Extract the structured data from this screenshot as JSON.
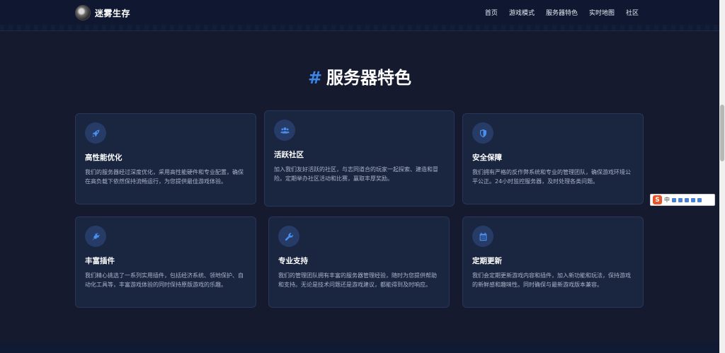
{
  "header": {
    "brand": "迷雾生存",
    "nav": [
      "首页",
      "游戏模式",
      "服务器特色",
      "实时地图",
      "社区"
    ]
  },
  "section": {
    "hash": "#",
    "title": "服务器特色"
  },
  "cards": [
    {
      "icon": "rocket-icon",
      "title": "高性能优化",
      "desc": "我们的服务器经过深度优化，采用高性能硬件和专业配置，确保在高负载下依然保持流畅运行，为您提供最佳游戏体验。"
    },
    {
      "icon": "users-icon",
      "title": "活跃社区",
      "desc": "加入我们友好活跃的社区，与志同道合的玩家一起探索、建造和冒险。定期举办社区活动和比赛，赢取丰厚奖励。"
    },
    {
      "icon": "shield-icon",
      "title": "安全保障",
      "desc": "我们拥有严格的反作弊系统和专业的管理团队，确保游戏环境公平公正。24小时监控服务器，及时处理各类问题。"
    },
    {
      "icon": "plug-icon",
      "title": "丰富插件",
      "desc": "我们精心挑选了一系列实用插件，包括经济系统、领地保护、自动化工具等，丰富游戏体验的同时保持原版游戏的乐趣。"
    },
    {
      "icon": "wrench-icon",
      "title": "专业支持",
      "desc": "我们的管理团队拥有丰富的服务器管理经验，随时为您提供帮助和支持。无论是技术问题还是游戏建议，都能得到及时响应。"
    },
    {
      "icon": "calendar-icon",
      "title": "定期更新",
      "desc": "我们会定期更新游戏内容和插件，加入新功能和玩法，保持游戏的新鲜感和趣味性。同时确保与最新游戏版本兼容。"
    }
  ],
  "ime": {
    "logo": "S",
    "lang": "中"
  },
  "colors": {
    "accent": "#3c86e8",
    "background": "#151a2e",
    "card": "#1a2540"
  }
}
